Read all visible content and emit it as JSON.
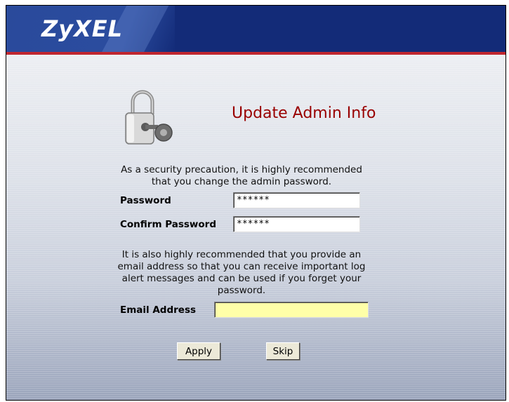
{
  "header": {
    "logo_text": "ZyXEL"
  },
  "page": {
    "title": "Update Admin Info"
  },
  "intro": {
    "line1": "As a security precaution, it is highly recommended",
    "line2": "that you change the admin password."
  },
  "password": {
    "label": "Password",
    "value": "******"
  },
  "confirm_password": {
    "label": "Confirm Password",
    "value": "******"
  },
  "email_note": {
    "line1": "It is also highly recommended that you provide an",
    "line2": "email address so that you can receive important log",
    "line3": "alert messages and can be used if you forget your",
    "line4": "password."
  },
  "email": {
    "label": "Email Address",
    "value": ""
  },
  "buttons": {
    "apply_label": "Apply",
    "skip_label": "Skip"
  },
  "colors": {
    "header_bg": "#132b78",
    "accent_red": "#c0262f",
    "title_red": "#990000",
    "email_field_bg": "#ffffa8"
  },
  "icons": {
    "lock": "padlock-key-icon"
  }
}
